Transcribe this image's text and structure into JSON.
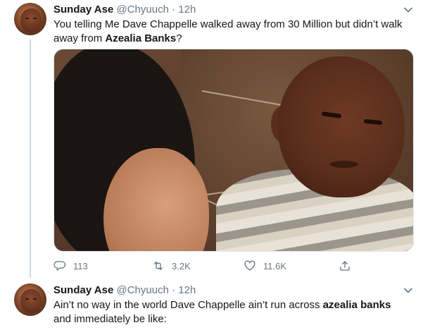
{
  "tweet1": {
    "name": "Sunday Ase",
    "handle": "@Chyuuch",
    "separator": "·",
    "time": "12h",
    "text_part1": "You telling Me Dave Chappelle walked away from 30 Million but didn’t walk away from ",
    "text_bold": "Azealia Banks",
    "text_part2": "?",
    "actions": {
      "reply_count": "113",
      "retweet_count": "3.2K",
      "like_count": "11.6K"
    }
  },
  "tweet2": {
    "name": "Sunday Ase",
    "handle": "@Chyuuch",
    "separator": "·",
    "time": "12h",
    "text_part1": "Ain’t no way in the world Dave Chappelle ain’t run across ",
    "text_bold": "azealia banks",
    "text_part2": " and immediately be like:"
  },
  "icons": {
    "reply": "reply-icon",
    "retweet": "retweet-icon",
    "like": "heart-icon",
    "share": "share-icon",
    "more": "chevron-down-icon"
  },
  "colors": {
    "text": "#14171a",
    "secondary": "#657786",
    "thread_line": "#ccd6dd"
  }
}
